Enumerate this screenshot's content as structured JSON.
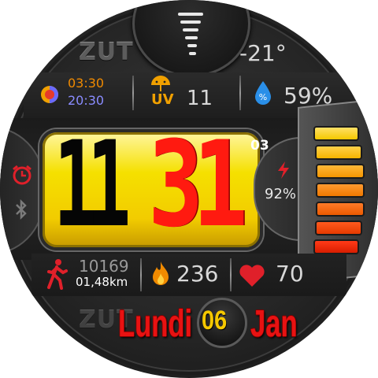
{
  "brand": {
    "text": "ZUT",
    "echo": "ZUT"
  },
  "weather": {
    "temperature": "-21°",
    "icon": "fog-icon"
  },
  "sun": {
    "sunrise": "03:30",
    "sunset": "20:30",
    "icon": "sun-moon-icon",
    "sunrise_color": "#f08a00",
    "sunset_color": "#8a8cff"
  },
  "uv": {
    "label": "UV",
    "value": "11",
    "icon": "umbrella-uv-icon",
    "color": "#f0a000"
  },
  "humidity": {
    "value": "59%",
    "icon": "water-drop-icon",
    "color": "#2a8fe8"
  },
  "time": {
    "hour": "11",
    "minute": "31",
    "seconds": "03",
    "hour_color": "#000000",
    "minute_color": "#ff1a10",
    "panel_color": "#f5d800"
  },
  "left_icons": {
    "alarm_icon": "alarm-clock-icon",
    "bluetooth_icon": "bluetooth-icon"
  },
  "battery": {
    "percent_label": "92%",
    "level": 0.92,
    "icon": "lightning-icon",
    "segments": 7
  },
  "steps": {
    "count": "10169",
    "distance": "01,48km",
    "icon": "walking-person-icon"
  },
  "calories": {
    "value": "236",
    "icon": "flame-icon",
    "color": "#f08a00"
  },
  "heart_rate": {
    "value": "70",
    "icon": "heart-icon",
    "color": "#e0202a"
  },
  "date": {
    "weekday": "Lundi",
    "day": "06",
    "month": "Jan"
  }
}
